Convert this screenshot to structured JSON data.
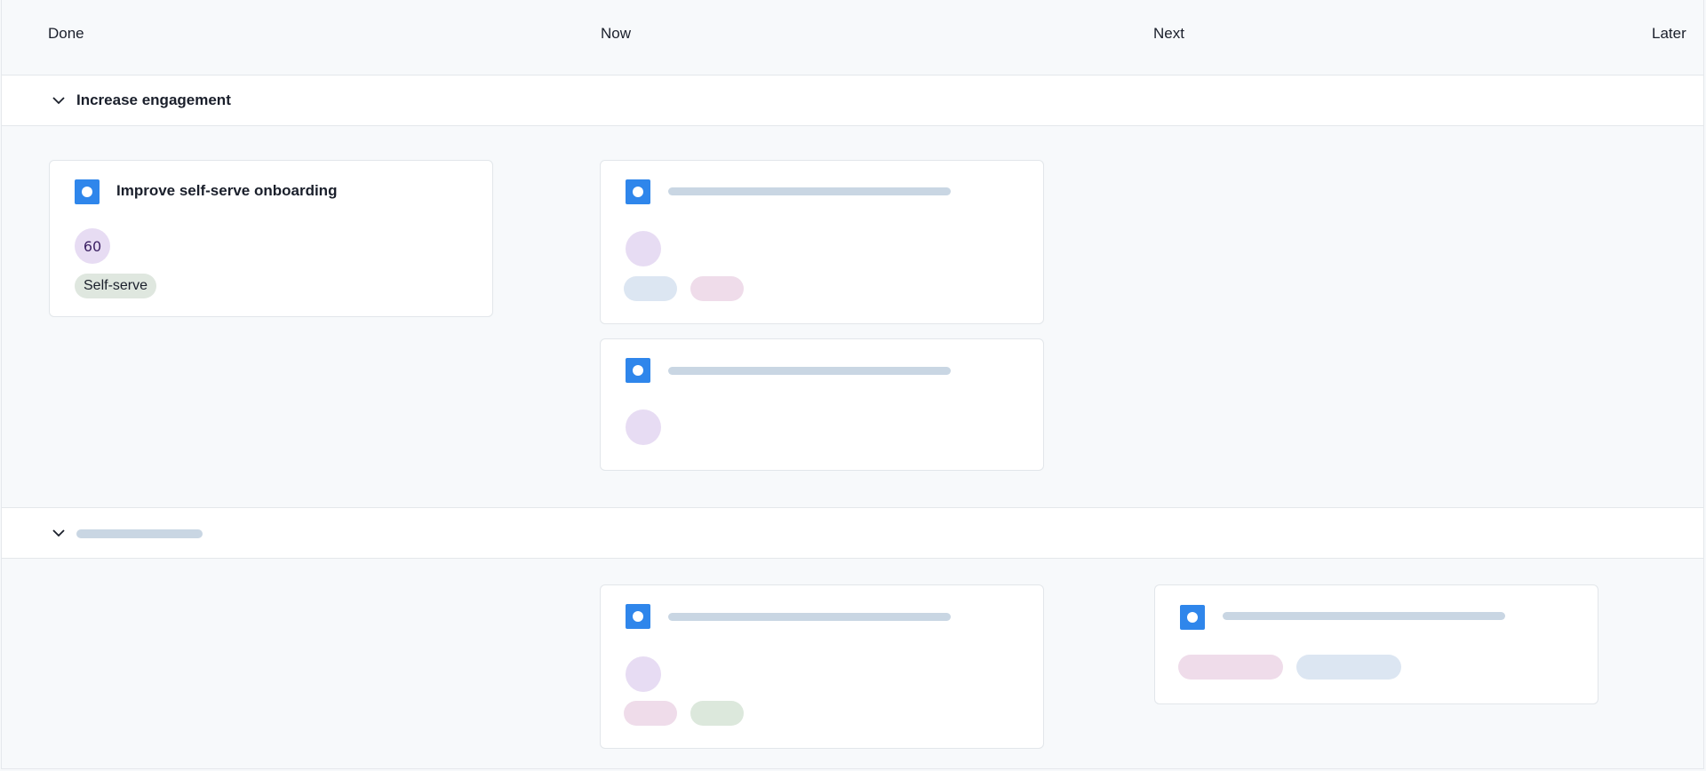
{
  "columns": [
    {
      "label": "Done"
    },
    {
      "label": "Now"
    },
    {
      "label": "Next"
    },
    {
      "label": "Later"
    }
  ],
  "groups": [
    {
      "title": "Increase engagement",
      "expanded": true
    },
    {
      "title": "",
      "expanded": true
    }
  ],
  "cards": {
    "onboarding": {
      "title": "Improve self-serve onboarding",
      "score": "60",
      "tag": "Self-serve"
    }
  },
  "colors": {
    "type_icon": "#2f86eb",
    "score_bg": "#e7dcf3",
    "tag_bg": "#dfe7df",
    "skeleton": "#c9d6e3"
  },
  "icons": {
    "collapse": "chevron-down-icon",
    "card_type": "initiative-icon"
  }
}
